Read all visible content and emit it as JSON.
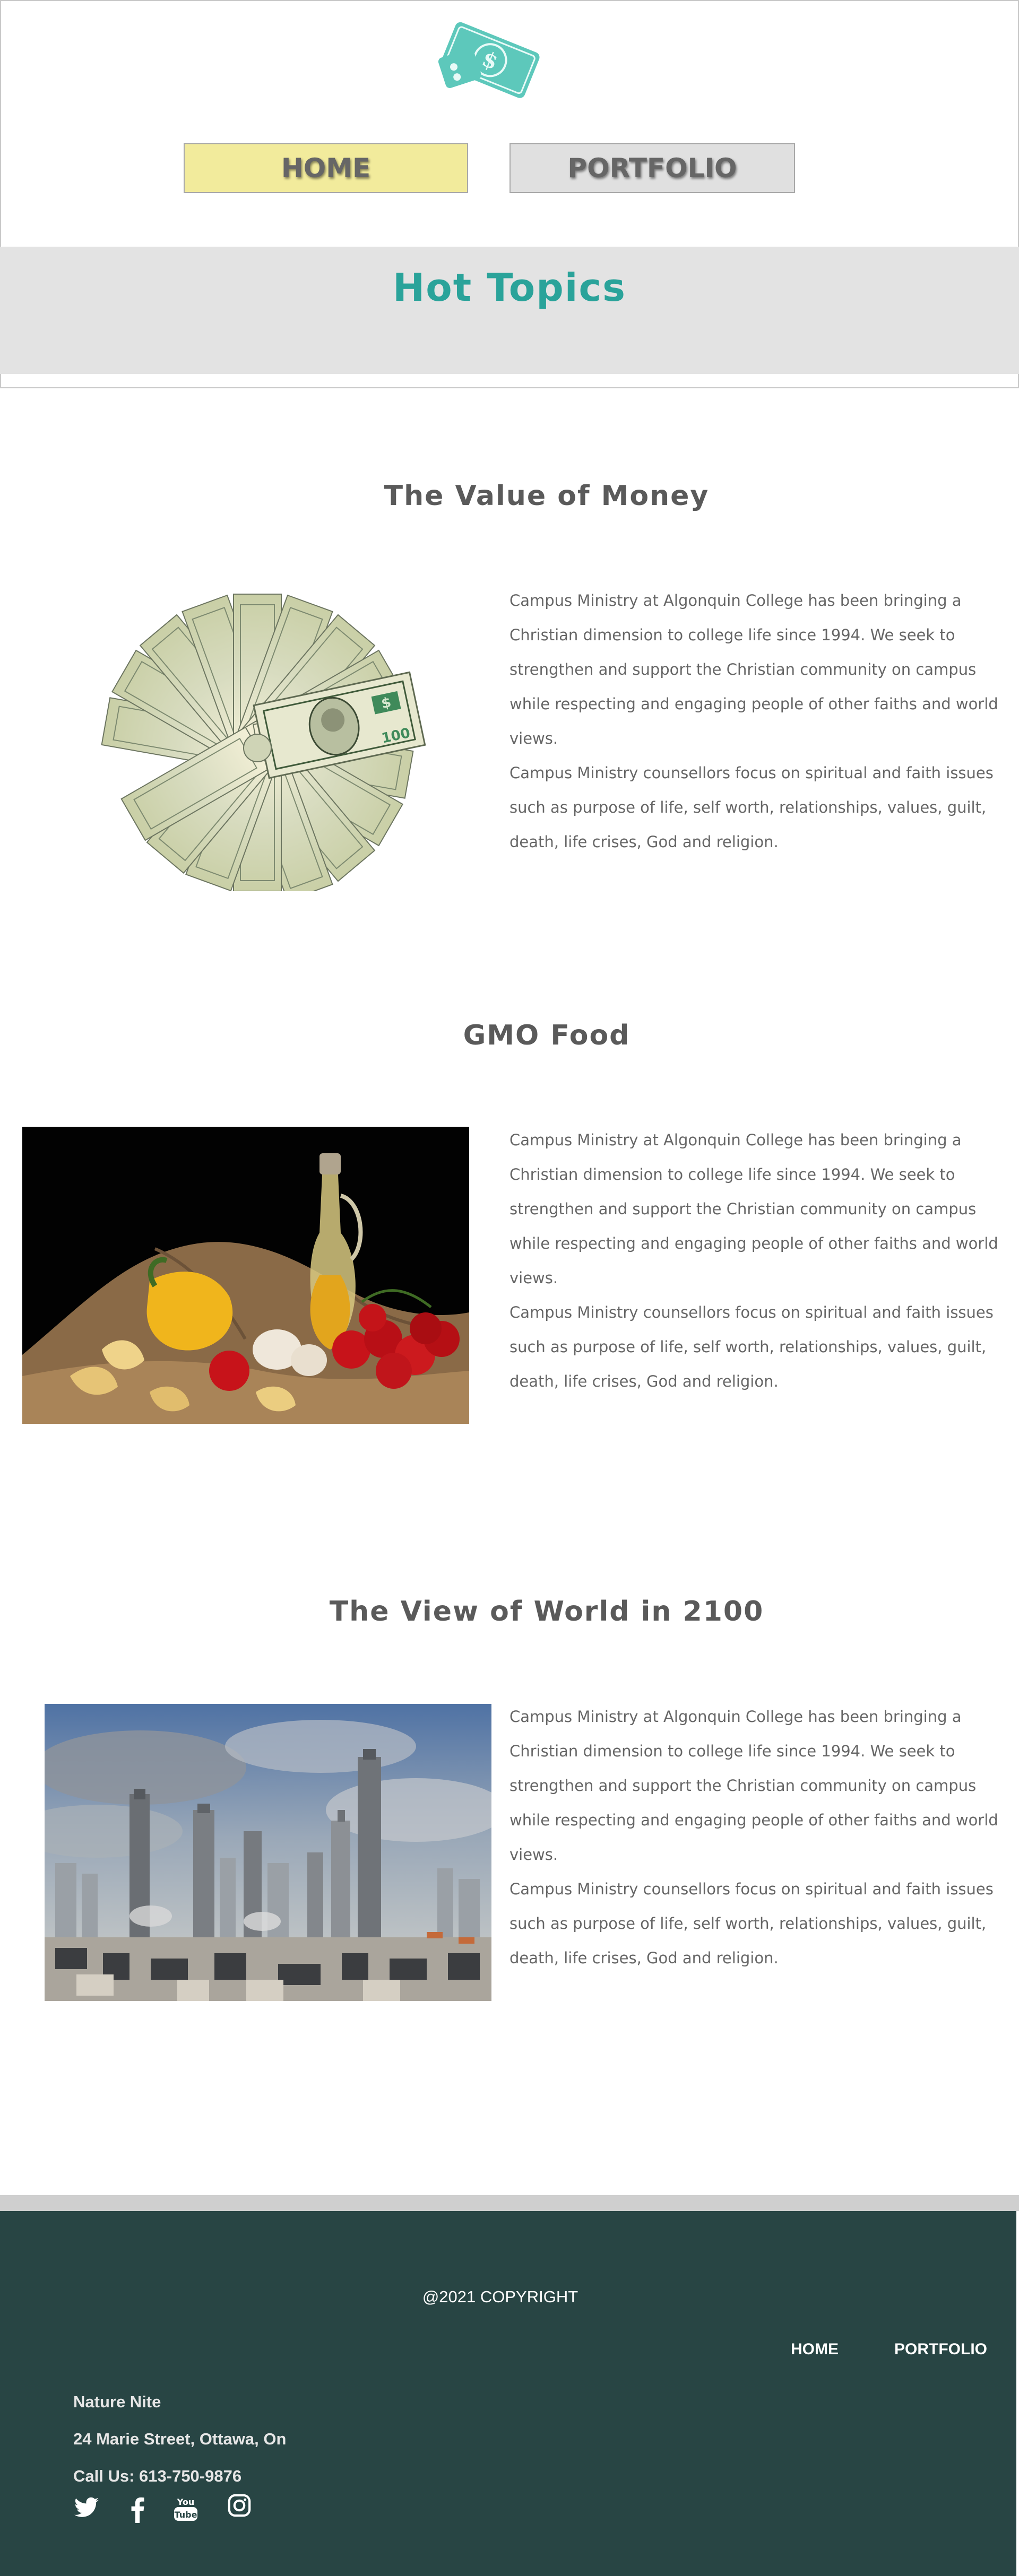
{
  "header": {
    "nav": {
      "home": "HOME",
      "portfolio": "PORTFOLIO"
    },
    "banner_title": "Hot Topics",
    "accent_color": "#2aa39a",
    "logo_icon": "money-bill-icon"
  },
  "sections": [
    {
      "title": "The Value of Money",
      "image": "fan-of-hundred-dollar-bills",
      "paragraph1": "Campus Ministry at Algonquin College has been bringing a Christian dimension to college life since 1994. We seek to strengthen and support the Christian community on campus while respecting and engaging people of other faiths and world views.",
      "paragraph2": "Campus Ministry counsellors focus on spiritual and faith issues such as purpose of life, self worth, relationships, values, guilt, death, life crises, God and religion."
    },
    {
      "title": "GMO Food",
      "image": "vegetables-oil-pasta-still-life",
      "paragraph1": "Campus Ministry at Algonquin College has been bringing a Christian dimension to college life since 1994. We seek to strengthen and support the Christian community on campus while respecting and engaging people of other faiths and world views.",
      "paragraph2": "Campus Ministry counsellors focus on spiritual and faith issues such as purpose of life, self worth, relationships, values, guilt, death, life crises, God and religion."
    },
    {
      "title": "The View of World in 2100",
      "image": "futuristic-city-skyline",
      "paragraph1": "Campus Ministry at Algonquin College has been bringing a Christian dimension to college life since 1994. We seek to strengthen and support the Christian community on campus while respecting and engaging people of other faiths and world views.",
      "paragraph2": "Campus Ministry counsellors focus on spiritual and faith issues such as purpose of life, self worth, relationships, values, guilt, death, life crises, God and religion."
    }
  ],
  "footer": {
    "copyright": "@2021 COPYRIGHT",
    "links": {
      "home": "HOME",
      "portfolio": "PORTFOLIO"
    },
    "name": "Nature Nite",
    "address": "24 Marie Street, Ottawa, On",
    "phone": "Call Us: 613-750-9876",
    "background_color": "#284544",
    "social_icons": [
      "twitter-icon",
      "facebook-icon",
      "youtube-icon",
      "instagram-icon"
    ]
  }
}
